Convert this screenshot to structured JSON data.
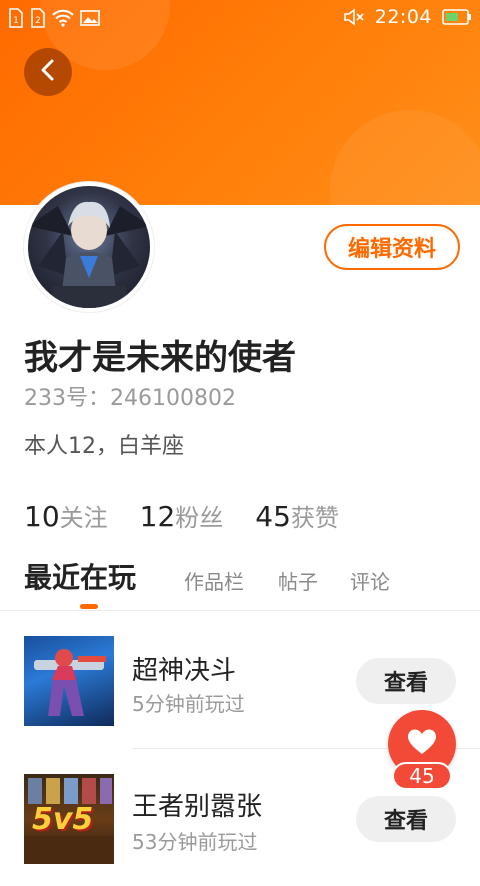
{
  "status_bar": {
    "time": "22:04",
    "icons": [
      "sim1-icon",
      "sim2-icon",
      "wifi-icon",
      "image-icon",
      "mute-icon",
      "battery-icon"
    ]
  },
  "profile": {
    "username": "我才是未来的使者",
    "id_label": "233号：246100802",
    "bio": "本人12，白羊座",
    "edit_label": "编辑资料"
  },
  "stats": {
    "following_count": "10",
    "following_label": "关注",
    "fans_count": "12",
    "fans_label": "粉丝",
    "likes_count": "45",
    "likes_label": "获赞"
  },
  "tabs": {
    "recent": "最近在玩",
    "works": "作品栏",
    "posts": "帖子",
    "comments": "评论"
  },
  "games": [
    {
      "title": "超神决斗",
      "subtitle": "5分钟前玩过",
      "action": "查看"
    },
    {
      "title": "王者别嚣张",
      "subtitle": "53分钟前玩过",
      "action": "查看",
      "thumb_text": "5v5"
    }
  ],
  "like": {
    "count": "45"
  },
  "colors": {
    "accent": "#ff6a00",
    "like_red": "#f24a36"
  }
}
